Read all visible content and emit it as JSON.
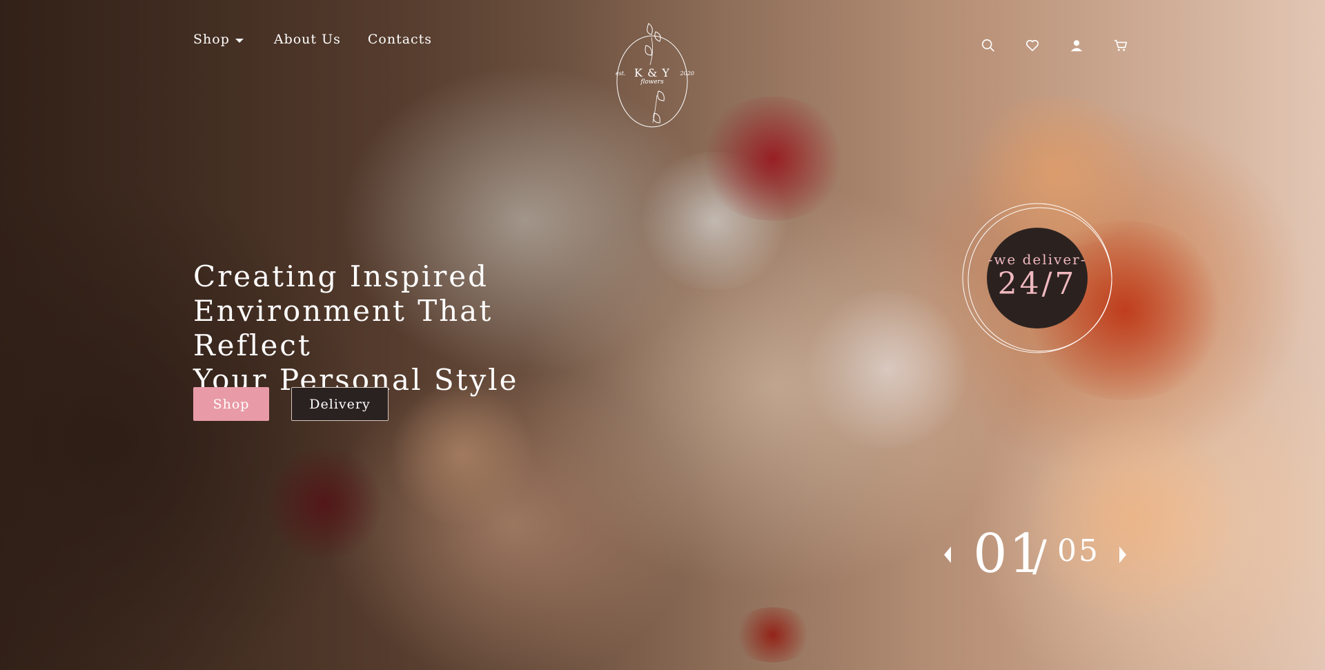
{
  "nav": {
    "links": [
      {
        "label": "Shop",
        "has_dropdown": true
      },
      {
        "label": "About Us"
      },
      {
        "label": "Contacts"
      }
    ],
    "icons": [
      "search-icon",
      "heart-icon",
      "user-icon",
      "cart-icon"
    ]
  },
  "logo": {
    "name": "K & Y",
    "sub": "flowers",
    "est": "est.",
    "year": "2020"
  },
  "hero": {
    "title_lines": [
      "Creating Inspired",
      "Environment That Reflect",
      "Your Personal Style"
    ],
    "shop_button": "Shop",
    "delivery_button": "Delivery"
  },
  "badge": {
    "top": "-we deliver-",
    "main": "24/7"
  },
  "slider": {
    "current": "01",
    "separator": "/",
    "total": "05"
  },
  "colors": {
    "accent_pink": "#e89aa6",
    "badge_dark": "#2b2220",
    "badge_text": "#f0b8bf"
  }
}
